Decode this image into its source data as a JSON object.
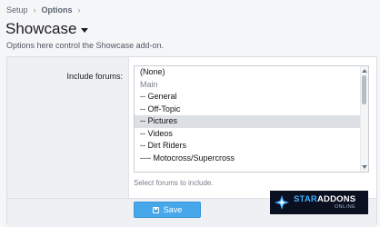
{
  "breadcrumb": {
    "items": [
      "Setup",
      "Options"
    ]
  },
  "page": {
    "title": "Showcase",
    "description": "Options here control the Showcase add-on."
  },
  "form": {
    "include_forums_label": "Include forums:",
    "forum_options": [
      {
        "label": "(None)",
        "muted": false,
        "selected": false
      },
      {
        "label": "Main",
        "muted": true,
        "selected": false
      },
      {
        "label": "-- General",
        "muted": false,
        "selected": false
      },
      {
        "label": "-- Off-Topic",
        "muted": false,
        "selected": false
      },
      {
        "label": "-- Pictures",
        "muted": false,
        "selected": true
      },
      {
        "label": "-- Videos",
        "muted": false,
        "selected": false
      },
      {
        "label": "-- Dirt Riders",
        "muted": false,
        "selected": false
      },
      {
        "label": "---- Motocross/Supercross",
        "muted": false,
        "selected": false
      }
    ],
    "hint": "Select forums to include.",
    "save_label": "Save"
  },
  "watermark": {
    "text_a": "STAR",
    "text_b": "ADDONS",
    "text_c": "ONLINE"
  },
  "colors": {
    "accent": "#47a7eb",
    "selected_row": "#dcdfe3",
    "panel_bg": "#ffffff",
    "page_bg": "#f5f6f8"
  }
}
